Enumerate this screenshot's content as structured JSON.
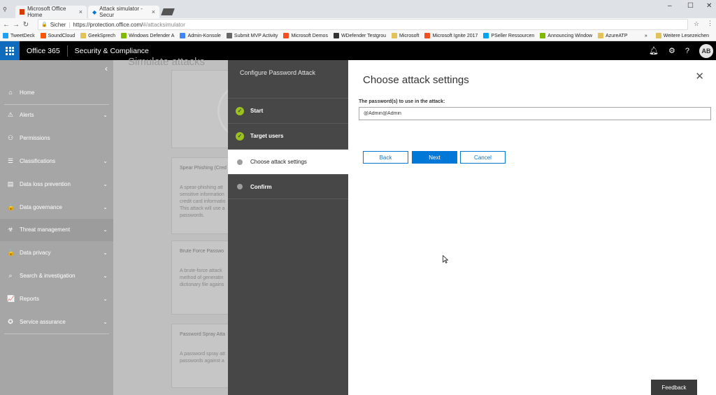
{
  "browser": {
    "tabs": [
      {
        "title": "Microsoft Office Home",
        "close": "×",
        "active": false
      },
      {
        "title": "Attack simulator - Secur",
        "close": "×",
        "active": true
      }
    ],
    "window_controls": [
      "–",
      "☐",
      "✕"
    ],
    "security_label": "Sicher",
    "url_base": "https://protection.office.com/",
    "url_rest": "#/attacksimulator",
    "bookmarks": [
      {
        "label": "TweetDeck",
        "color": "#1da1f2"
      },
      {
        "label": "SoundCloud",
        "color": "#ff5500"
      },
      {
        "label": "GeekSprech",
        "color": "#e3c25a"
      },
      {
        "label": "Windows Defender A",
        "color": "#7fba00"
      },
      {
        "label": "Admin-Konsole",
        "color": "#4285f4"
      },
      {
        "label": "Submit MVP Activity",
        "color": "#666666"
      },
      {
        "label": "Microsoft Demos",
        "color": "#f25022"
      },
      {
        "label": "WDefender Testgrou",
        "color": "#333333"
      },
      {
        "label": "Microsoft",
        "color": "#e3c25a"
      },
      {
        "label": "Microsoft Ignite 2017",
        "color": "#f25022"
      },
      {
        "label": "PSeller Ressourcen",
        "color": "#00a4ef"
      },
      {
        "label": "Announcing Window",
        "color": "#7fba00"
      },
      {
        "label": "AzureATP",
        "color": "#e3c25a"
      }
    ],
    "more_bookmarks": "»",
    "other_bookmarks": "Weitere Lesezeichen"
  },
  "header": {
    "product": "Office 365",
    "app": "Security & Compliance",
    "avatar": "AB",
    "accent": "#0f6cbd"
  },
  "sidebar": {
    "collapse": "‹",
    "items": [
      {
        "label": "Home",
        "icon": "home-icon",
        "glyph": "⌂",
        "chevron": ""
      },
      {
        "label": "Alerts",
        "icon": "alert-icon",
        "glyph": "⚠",
        "chevron": "⌄"
      },
      {
        "label": "Permissions",
        "icon": "permissions-icon",
        "glyph": "⚇",
        "chevron": ""
      },
      {
        "label": "Classifications",
        "icon": "classifications-icon",
        "glyph": "☰",
        "chevron": "⌄"
      },
      {
        "label": "Data loss prevention",
        "icon": "dlp-icon",
        "glyph": "▤",
        "chevron": "⌄"
      },
      {
        "label": "Data governance",
        "icon": "lock-icon",
        "glyph": "🔒",
        "chevron": "⌄"
      },
      {
        "label": "Threat management",
        "icon": "biohazard-icon",
        "glyph": "☣",
        "chevron": "⌄"
      },
      {
        "label": "Data privacy",
        "icon": "lock-icon",
        "glyph": "🔒",
        "chevron": "⌄"
      },
      {
        "label": "Search & investigation",
        "icon": "search-icon",
        "glyph": "⌕",
        "chevron": "⌄"
      },
      {
        "label": "Reports",
        "icon": "chart-icon",
        "glyph": "📈",
        "chevron": "⌄"
      },
      {
        "label": "Service assurance",
        "icon": "assurance-icon",
        "glyph": "✪",
        "chevron": "⌄"
      }
    ]
  },
  "background_page": {
    "title": "Simulate attacks",
    "cards": [
      {
        "title": "Spear Phishing (Cred",
        "desc": [
          "A spear-phishing att",
          "sensitive information",
          "credit card informatio",
          "This attack will use a",
          "passwords."
        ]
      },
      {
        "title": "Brute Force Passwo",
        "desc": [
          "A brute-force attack",
          "method of generatin",
          "dictionary file agains"
        ]
      },
      {
        "title": "Password Spray Atta",
        "desc": [
          "A password spray att",
          "passwords against a"
        ]
      }
    ]
  },
  "wizard": {
    "title": "Configure Password Attack",
    "steps": [
      {
        "label": "Start",
        "state": "done"
      },
      {
        "label": "Target users",
        "state": "done"
      },
      {
        "label": "Choose attack settings",
        "state": "current"
      },
      {
        "label": "Confirm",
        "state": "pending"
      }
    ],
    "check": "✓",
    "heading": "Choose attack settings",
    "close": "✕",
    "field_label": "The password(s) to use in the attack:",
    "field_value": "@Admin@Admin",
    "buttons": {
      "back": "Back",
      "next": "Next",
      "cancel": "Cancel"
    }
  },
  "feedback": "Feedback"
}
